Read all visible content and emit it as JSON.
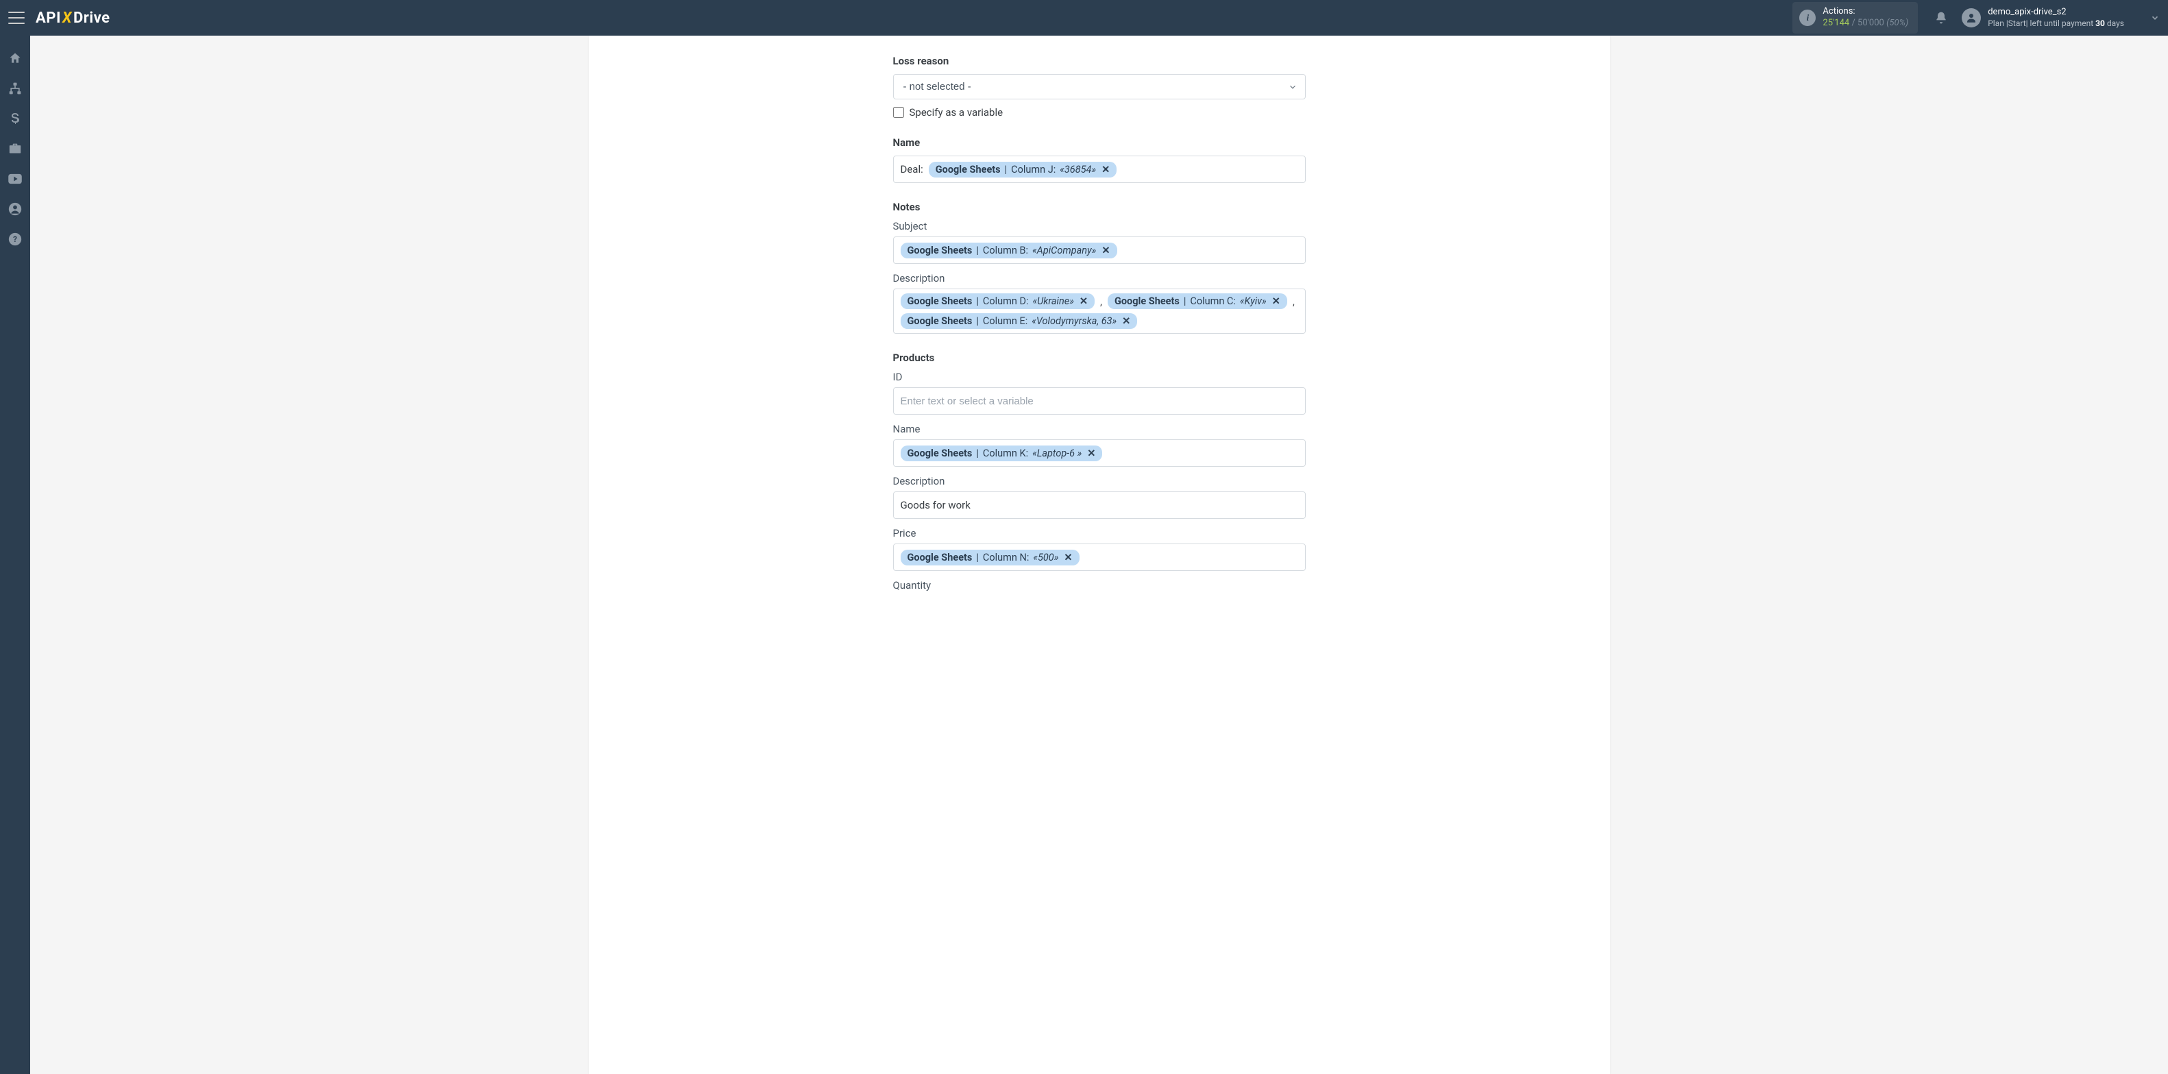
{
  "header": {
    "logo_a": "API",
    "logo_b": "X",
    "logo_c": "Drive",
    "actions_label": "Actions:",
    "actions_used": "25'144",
    "actions_sep": " / ",
    "actions_total": "50'000",
    "actions_pct": "(50%)",
    "user_name": "demo_apix-drive_s2",
    "plan_prefix": "Plan |Start| left until payment ",
    "plan_days": "30",
    "plan_suffix": " days"
  },
  "form": {
    "loss_reason": {
      "label": "Loss reason",
      "value": "- not selected -",
      "checkbox": "Specify as a variable"
    },
    "name": {
      "label": "Name",
      "prefix": "Deal:",
      "chips": [
        {
          "source": "Google Sheets",
          "column": "Column J:",
          "value": "«36854»"
        }
      ]
    },
    "notes": {
      "label": "Notes",
      "subject": {
        "label": "Subject",
        "chips": [
          {
            "source": "Google Sheets",
            "column": "Column B:",
            "value": "«ApiCompany»"
          }
        ]
      },
      "description": {
        "label": "Description",
        "chips": [
          {
            "source": "Google Sheets",
            "column": "Column D:",
            "value": "«Ukraine»"
          },
          {
            "source": "Google Sheets",
            "column": "Column C:",
            "value": "«Kyiv»"
          },
          {
            "source": "Google Sheets",
            "column": "Column E:",
            "value": "«Volodymyrska, 63»"
          }
        ],
        "separators": [
          ",",
          ","
        ]
      }
    },
    "products": {
      "label": "Products",
      "id": {
        "label": "ID",
        "placeholder": "Enter text or select a variable"
      },
      "name": {
        "label": "Name",
        "chips": [
          {
            "source": "Google Sheets",
            "column": "Column K:",
            "value": "«Laptop-6 »"
          }
        ]
      },
      "description": {
        "label": "Description",
        "text": "Goods for work"
      },
      "price": {
        "label": "Price",
        "chips": [
          {
            "source": "Google Sheets",
            "column": "Column N:",
            "value": "«500»"
          }
        ]
      },
      "quantity": {
        "label": "Quantity"
      }
    }
  }
}
